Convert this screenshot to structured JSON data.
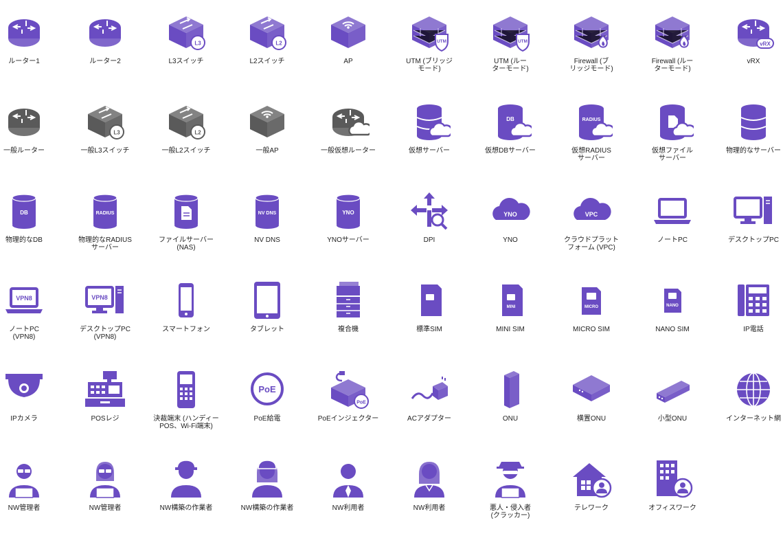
{
  "colors": {
    "purple": "#6a4cc2",
    "gray": "#5a5a5a",
    "white": "#ffffff"
  },
  "items": [
    {
      "label": "ルーター1",
      "icon": "router-icon",
      "color": "purple"
    },
    {
      "label": "ルーター2",
      "icon": "router-icon",
      "color": "purple"
    },
    {
      "label": "L3スイッチ",
      "icon": "l3-switch-icon",
      "color": "purple",
      "badge": "L3"
    },
    {
      "label": "L2スイッチ",
      "icon": "l2-switch-icon",
      "color": "purple",
      "badge": "L2"
    },
    {
      "label": "AP",
      "icon": "access-point-icon",
      "color": "purple"
    },
    {
      "label": "UTM (ブリッジ\nモード)",
      "icon": "utm-icon",
      "color": "purple",
      "badge": "UTM"
    },
    {
      "label": "UTM (ルー\nターモード)",
      "icon": "utm-icon",
      "color": "purple",
      "badge": "UTM"
    },
    {
      "label": "Firewall (ブ\nリッジモード)",
      "icon": "firewall-icon",
      "color": "purple"
    },
    {
      "label": "Firewall (ルー\nターモード)",
      "icon": "firewall-icon",
      "color": "purple"
    },
    {
      "label": "vRX",
      "icon": "vrx-router-icon",
      "color": "purple",
      "badge": "vRX"
    },
    {
      "label": "一般ルーター",
      "icon": "router-icon",
      "color": "gray"
    },
    {
      "label": "一般L3スイッチ",
      "icon": "l3-switch-icon",
      "color": "gray",
      "badge": "L3"
    },
    {
      "label": "一般L2スイッチ",
      "icon": "l2-switch-icon",
      "color": "gray",
      "badge": "L2"
    },
    {
      "label": "一般AP",
      "icon": "access-point-icon",
      "color": "gray"
    },
    {
      "label": "一般仮想ルーター",
      "icon": "virtual-router-icon",
      "color": "gray"
    },
    {
      "label": "仮想サーバー",
      "icon": "virtual-server-icon",
      "color": "purple"
    },
    {
      "label": "仮想DBサーバー",
      "icon": "virtual-db-server-icon",
      "color": "purple",
      "badge": "DB"
    },
    {
      "label": "仮想RADIUS\nサーバー",
      "icon": "virtual-radius-server-icon",
      "color": "purple",
      "badge": "RADIUS"
    },
    {
      "label": "仮想ファイル\nサーバー",
      "icon": "virtual-file-server-icon",
      "color": "purple"
    },
    {
      "label": "物理的なサーバー",
      "icon": "physical-server-icon",
      "color": "purple"
    },
    {
      "label": "物理的なDB",
      "icon": "database-icon",
      "color": "purple",
      "badge": "DB"
    },
    {
      "label": "物理的なRADIUS\nサーバー",
      "icon": "radius-server-icon",
      "color": "purple",
      "badge": "RADIUS"
    },
    {
      "label": "ファイルサーバー\n(NAS)",
      "icon": "file-server-icon",
      "color": "purple"
    },
    {
      "label": "NV DNS",
      "icon": "dns-server-icon",
      "color": "purple",
      "badge": "NV DNS"
    },
    {
      "label": "YNOサーバー",
      "icon": "yno-server-icon",
      "color": "purple",
      "badge": "YNO"
    },
    {
      "label": "DPI",
      "icon": "dpi-icon",
      "color": "purple"
    },
    {
      "label": "YNO",
      "icon": "yno-cloud-icon",
      "color": "purple",
      "badge": "YNO"
    },
    {
      "label": "クラウドプラット\nフォーム (VPC)",
      "icon": "vpc-cloud-icon",
      "color": "purple",
      "badge": "VPC"
    },
    {
      "label": "ノートPC",
      "icon": "laptop-icon",
      "color": "purple"
    },
    {
      "label": "デスクトップPC",
      "icon": "desktop-pc-icon",
      "color": "purple"
    },
    {
      "label": "ノートPC\n(VPN8)",
      "icon": "laptop-vpn-icon",
      "color": "purple",
      "badge": "VPN8"
    },
    {
      "label": "デスクトップPC\n(VPN8)",
      "icon": "desktop-vpn-icon",
      "color": "purple",
      "badge": "VPN8"
    },
    {
      "label": "スマートフォン",
      "icon": "smartphone-icon",
      "color": "purple"
    },
    {
      "label": "タブレット",
      "icon": "tablet-icon",
      "color": "purple"
    },
    {
      "label": "複合機",
      "icon": "multifunction-printer-icon",
      "color": "purple"
    },
    {
      "label": "標準SIM",
      "icon": "sim-card-icon",
      "color": "purple"
    },
    {
      "label": "MINI SIM",
      "icon": "mini-sim-icon",
      "color": "purple",
      "badge": "MINI"
    },
    {
      "label": "MICRO SIM",
      "icon": "micro-sim-icon",
      "color": "purple",
      "badge": "MICRO"
    },
    {
      "label": "NANO SIM",
      "icon": "nano-sim-icon",
      "color": "purple",
      "badge": "NANO"
    },
    {
      "label": "IP電話",
      "icon": "ip-phone-icon",
      "color": "purple"
    },
    {
      "label": "IPカメラ",
      "icon": "ip-camera-icon",
      "color": "purple"
    },
    {
      "label": "POSレジ",
      "icon": "pos-register-icon",
      "color": "purple"
    },
    {
      "label": "決裁端末 (ハンディー\nPOS、Wi-Fi端末)",
      "icon": "handheld-terminal-icon",
      "color": "purple"
    },
    {
      "label": "PoE給電",
      "icon": "poe-icon",
      "color": "purple",
      "badge": "PoE"
    },
    {
      "label": "PoEインジェクター",
      "icon": "poe-injector-icon",
      "color": "purple",
      "badge": "PoE"
    },
    {
      "label": "ACアダプター",
      "icon": "ac-adapter-icon",
      "color": "purple"
    },
    {
      "label": "ONU",
      "icon": "onu-tower-icon",
      "color": "purple"
    },
    {
      "label": "横置ONU",
      "icon": "onu-flat-icon",
      "color": "purple"
    },
    {
      "label": "小型ONU",
      "icon": "onu-small-icon",
      "color": "purple"
    },
    {
      "label": "インターネット網",
      "icon": "internet-globe-icon",
      "color": "purple"
    },
    {
      "label": "NW管理者",
      "icon": "admin-man-icon",
      "color": "purple"
    },
    {
      "label": "NW管理者",
      "icon": "admin-woman-icon",
      "color": "purple"
    },
    {
      "label": "NW構築の作業者",
      "icon": "worker-man-icon",
      "color": "purple"
    },
    {
      "label": "NW構築の作業者",
      "icon": "worker-woman-icon",
      "color": "purple"
    },
    {
      "label": "NW利用者",
      "icon": "user-man-icon",
      "color": "purple"
    },
    {
      "label": "NW利用者",
      "icon": "user-woman-icon",
      "color": "purple"
    },
    {
      "label": "悪人・侵入者\n(クラッカー)",
      "icon": "cracker-icon",
      "color": "purple"
    },
    {
      "label": "テレワーク",
      "icon": "telework-icon",
      "color": "purple"
    },
    {
      "label": "オフィスワーク",
      "icon": "office-work-icon",
      "color": "purple"
    }
  ]
}
